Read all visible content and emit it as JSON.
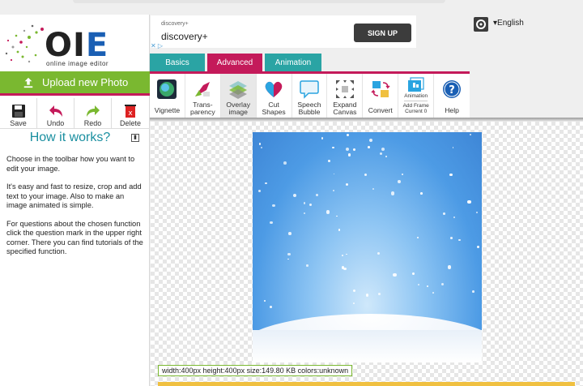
{
  "logo": {
    "text_o": "O",
    "text_i": "I",
    "text_e": "E",
    "subtitle": "online image editor"
  },
  "sidebar": {
    "upload_label": "Upload new Photo",
    "actions": [
      {
        "label": "Save",
        "icon": "save-icon"
      },
      {
        "label": "Undo",
        "icon": "undo-icon"
      },
      {
        "label": "Redo",
        "icon": "redo-icon"
      },
      {
        "label": "Delete",
        "icon": "delete-icon"
      }
    ],
    "how_title": "How it works?",
    "how_paragraphs": [
      "Choose in the toolbar how you want to edit your image.",
      "It's easy and fast to resize, crop and add text to your image. Also to make an image animated is simple.",
      "For questions about the chosen function click the question mark in the upper right corner. There you can find tutorials of the specified function."
    ]
  },
  "ad": {
    "small": "discovery+",
    "big": "discovery+",
    "button": "SIGN UP",
    "close": "✕ ▷"
  },
  "header": {
    "language": "▾English"
  },
  "tabs": [
    {
      "label": "Basics",
      "active": false
    },
    {
      "label": "Advanced",
      "active": true
    },
    {
      "label": "Animation",
      "active": false
    }
  ],
  "toolbar": [
    {
      "line1": "",
      "line2": "Vignette",
      "icon": "vignette-icon"
    },
    {
      "line1": "Trans-",
      "line2": "parency",
      "icon": "transparency-icon"
    },
    {
      "line1": "Overlay",
      "line2": "image",
      "icon": "overlay-icon",
      "selected": true
    },
    {
      "line1": "Cut",
      "line2": "Shapes",
      "icon": "heart-icon"
    },
    {
      "line1": "Speech",
      "line2": "Bubble",
      "icon": "speech-bubble-icon"
    },
    {
      "line1": "Expand",
      "line2": "Canvas",
      "icon": "expand-icon"
    },
    {
      "line1": "",
      "line2": "Convert",
      "icon": "convert-icon"
    },
    {
      "line1": "Add Frame",
      "line2": "Current 0",
      "top": "Animation",
      "icon": "animation-icon"
    },
    {
      "line1": "",
      "line2": "Help",
      "icon": "help-icon"
    }
  ],
  "image_info": "width:400px  height:400px  size:149.80 KB  colors:unknown",
  "colors": {
    "accent_green": "#7ab830",
    "accent_pink": "#c41a5a",
    "accent_teal": "#2aa4a4"
  }
}
